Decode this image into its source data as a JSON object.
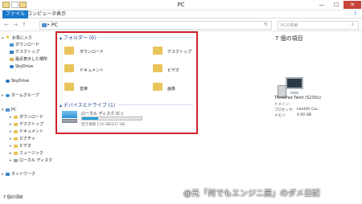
{
  "window": {
    "title": "PC",
    "min": "—",
    "max": "☐",
    "close": "✕"
  },
  "ribbon": {
    "tabs": [
      "ファイル",
      "コンピューター",
      "表示"
    ],
    "help": "?"
  },
  "nav": {
    "back": "←",
    "forward": "→",
    "up": "↑",
    "refresh": "↻"
  },
  "address": {
    "path": "PC",
    "prefix": "▸",
    "placeholder": "PCの検索"
  },
  "sidebar": {
    "favorites": "お気に入り",
    "fav_items": [
      "ダウンロード",
      "デスクトップ",
      "最近表示した場所",
      "SkyDrive"
    ],
    "skydrive": "SkyDrive",
    "homegroup": "ホームグループ",
    "pc": "PC",
    "pc_items": [
      "ダウンロード",
      "デスクトップ",
      "ドキュメント",
      "ピクチャ",
      "ビデオ",
      "ミュージック",
      "ローカル ディスク (C:)"
    ],
    "network": "ネットワーク"
  },
  "content": {
    "folders_header": "フォルダー (6)",
    "folders": [
      "ダウンロード",
      "デスクトップ",
      "ドキュメント",
      "ビデオ",
      "音楽",
      "画像"
    ],
    "drives_header": "デバイスとドライブ (1)",
    "drive": {
      "name": "ローカル ディスク (C:)",
      "free": "空き領域 174 GB/237 GB",
      "used_fraction": 0.27
    }
  },
  "details": {
    "title": "7 個の項目",
    "computer_name": "ThinkPad Twist (S230u)",
    "rows": [
      {
        "label": "ドメイン:",
        "value": ""
      },
      {
        "label": "プロセッサ:",
        "value": "Intel(R) Cor..."
      },
      {
        "label": "メモリ:",
        "value": "4.00 GB"
      }
    ]
  },
  "status": {
    "count": "7 個の項目"
  },
  "watermark": "@元「何でもエンジニ屋」のダメ日記",
  "colors": {
    "accent": "#1979ca",
    "frame": "#d4202a",
    "folder": "#e9c45a",
    "drive_bar": "#26a0da"
  }
}
